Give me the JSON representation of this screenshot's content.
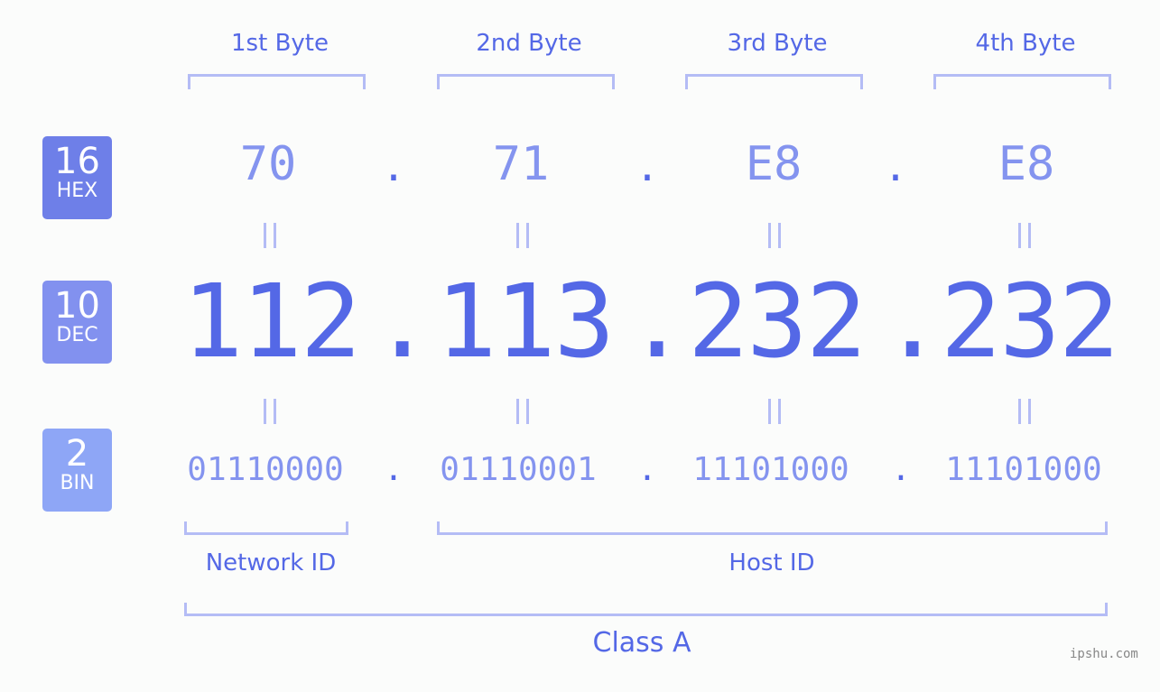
{
  "byte_headers": [
    "1st Byte",
    "2nd Byte",
    "3rd Byte",
    "4th Byte"
  ],
  "badges": {
    "hex": {
      "num": "16",
      "label": "HEX",
      "color": "#6e7fe8"
    },
    "dec": {
      "num": "10",
      "label": "DEC",
      "color": "#8291ef"
    },
    "bin": {
      "num": "2",
      "label": "BIN",
      "color": "#8ea6f6"
    }
  },
  "hex_values": [
    "70",
    "71",
    "E8",
    "E8"
  ],
  "dec_values": [
    "112",
    "113",
    "232",
    "232"
  ],
  "bin_values": [
    "01110000",
    "01110001",
    "11101000",
    "11101000"
  ],
  "separator": ".",
  "network_label": "Network ID",
  "host_label": "Host ID",
  "class_label": "Class A",
  "watermark": "ipshu.com"
}
